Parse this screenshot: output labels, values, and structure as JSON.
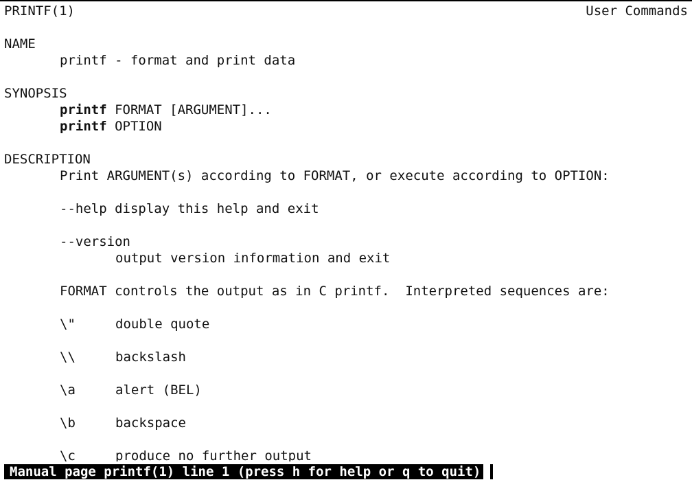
{
  "header": {
    "left": "PRINTF(1)",
    "right": "User Commands"
  },
  "sections": {
    "name_heading": "NAME",
    "name_text": "printf - format and print data",
    "synopsis_heading": "SYNOPSIS",
    "synopsis_cmd1": "printf",
    "synopsis_args1": "FORMAT [ARGUMENT]...",
    "synopsis_cmd2": "printf",
    "synopsis_args2": "OPTION",
    "description_heading": "DESCRIPTION",
    "description_text": "Print ARGUMENT(s) according to FORMAT, or execute according to OPTION:",
    "help_option": "--help",
    "help_desc": "display this help and exit",
    "version_option": "--version",
    "version_desc": "output version information and exit",
    "format_text": "FORMAT controls the output as in C printf.  Interpreted sequences are:"
  },
  "escapes": [
    {
      "seq": "\\\"",
      "desc": "double quote"
    },
    {
      "seq": "\\\\",
      "desc": "backslash"
    },
    {
      "seq": "\\a",
      "desc": "alert (BEL)"
    },
    {
      "seq": "\\b",
      "desc": "backspace"
    },
    {
      "seq": "\\c",
      "desc": "produce no further output"
    }
  ],
  "status_bar": {
    "text": "Manual page printf(1) line 1 (press h for help or q to quit)"
  }
}
